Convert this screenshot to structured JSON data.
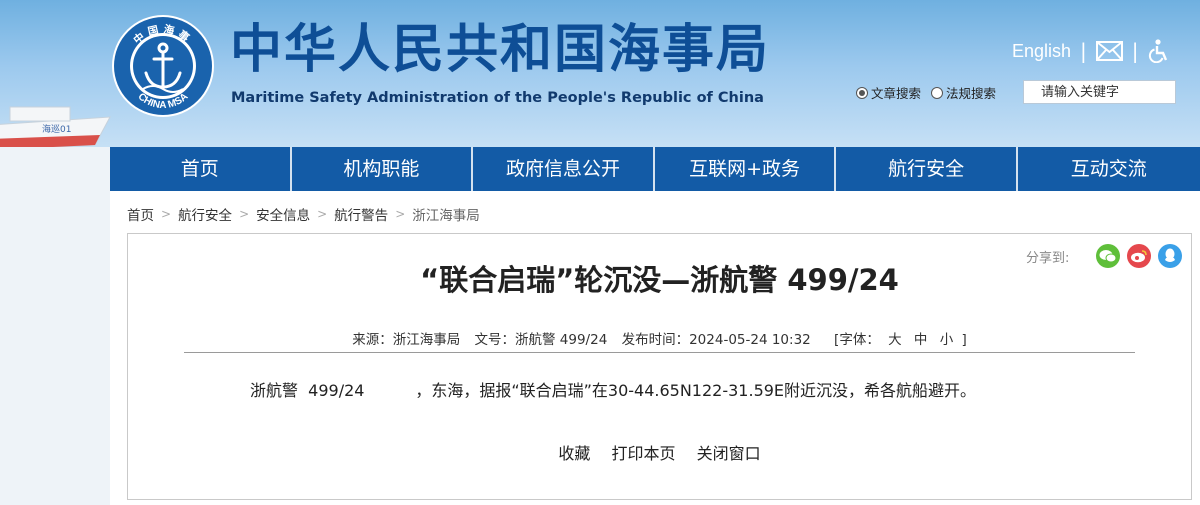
{
  "header": {
    "title_cn": "中华人民共和国海事局",
    "title_en": "Maritime Safety Administration of the People's Republic of China",
    "logo_text_top": "中国海事",
    "logo_text_bottom": "CHINA MSA",
    "ship_text": "海巡01",
    "english_link": "English",
    "search": {
      "option_article": "文章搜索",
      "option_law": "法规搜索",
      "selected": "文章搜索",
      "placeholder": "请输入关键字"
    }
  },
  "nav": {
    "items": [
      {
        "label": "首页"
      },
      {
        "label": "机构职能"
      },
      {
        "label": "政府信息公开"
      },
      {
        "label": "互联网+政务"
      },
      {
        "label": "航行安全"
      },
      {
        "label": "互动交流"
      }
    ]
  },
  "breadcrumb": [
    "首页",
    "航行安全",
    "安全信息",
    "航行警告",
    "浙江海事局"
  ],
  "article": {
    "share_label": "分享到:",
    "share_icons": [
      "wechat-icon",
      "weibo-icon",
      "qq-icon"
    ],
    "title": "“联合启瑞”轮沉没—浙航警 499/24",
    "source": "来源：浙江海事局",
    "doc_no": "文号：浙航警 499/24",
    "publish_time": "发布时间：2024-05-24 10:32",
    "font_size_label": "[字体：",
    "font_large": "大",
    "font_medium": "中",
    "font_small": "小",
    "font_close": "]",
    "body": "浙航警  499/24          ，东海，据报“联合启瑞”在30-44.65N122-31.59E附近沉没，希各航船避开。",
    "actions": {
      "favorite": "收藏",
      "print": "打印本页",
      "close": "关闭窗口"
    }
  },
  "colors": {
    "brand_blue": "#135ba6",
    "title_blue": "#0e4e96",
    "wechat": "#5fbf3a",
    "weibo": "#e5484d",
    "qq": "#3aa0e8"
  }
}
